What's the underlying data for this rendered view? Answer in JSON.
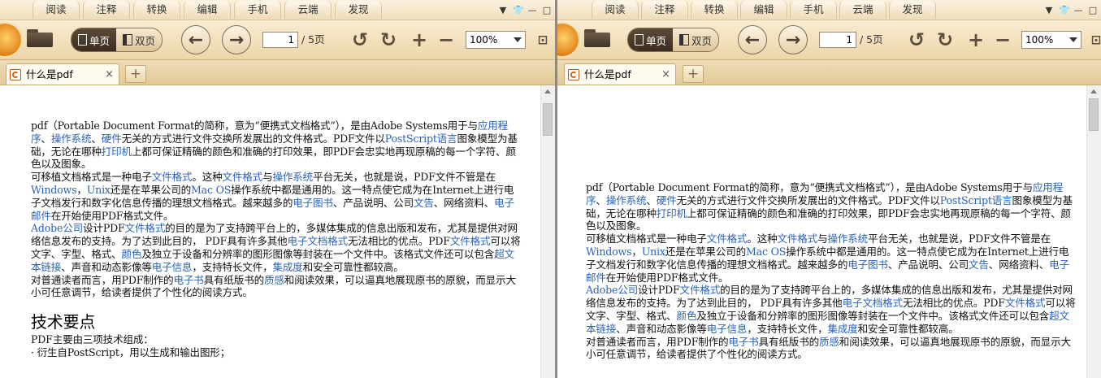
{
  "menu": [
    "阅读",
    "注释",
    "转换",
    "编辑",
    "手机",
    "云端",
    "发现"
  ],
  "toolbar": {
    "single_page_label": "单页",
    "double_page_label": "双页",
    "current_page": "1",
    "total_pages": "/ 5页",
    "zoom": "100%"
  },
  "tab": {
    "title": "什么是pdf",
    "close": "×",
    "add": "+"
  },
  "doc": {
    "p1": [
      {
        "t": "pdf（Portable Document Format的简称，意为“便携式文档格式”），是由Adobe Systems用于与"
      },
      {
        "t": "应用程序",
        "link": true
      },
      {
        "t": "、"
      },
      {
        "t": "操作系统",
        "link": true
      },
      {
        "t": "、"
      },
      {
        "t": "硬件",
        "link": true
      },
      {
        "t": "无关的方式进行文件交换所发展出的文件格式。PDF文件以"
      },
      {
        "t": "PostScript语言",
        "link": true
      },
      {
        "t": "图象模型为基础，无论在哪种"
      },
      {
        "t": "打印机",
        "link": true
      },
      {
        "t": "上都可保证精确的颜色和准确的打印效果，即PDF会忠实地再现原稿的每一个字符、颜色以及图象。"
      }
    ],
    "p2": [
      {
        "t": "可移植文档格式是一种电子"
      },
      {
        "t": "文件格式",
        "link": true
      },
      {
        "t": "。这种"
      },
      {
        "t": "文件格式",
        "link": true
      },
      {
        "t": "与"
      },
      {
        "t": "操作系统",
        "link": true
      },
      {
        "t": "平台无关，也就是说，PDF文件不管是在"
      },
      {
        "t": "Windows",
        "link": true
      },
      {
        "t": "，"
      },
      {
        "t": "Unix",
        "link": true
      },
      {
        "t": "还是在苹果公司的"
      },
      {
        "t": "Mac OS",
        "link": true
      },
      {
        "t": "操作系统中都是通用的。这一特点使它成为在Internet上进行电子文档发行和数字化信息传播的理想文档格式。越来越多的"
      },
      {
        "t": "电子图书",
        "link": true
      },
      {
        "t": "、产品说明、公司"
      },
      {
        "t": "文告",
        "link": true
      },
      {
        "t": "、网络资料、"
      },
      {
        "t": "电子邮件",
        "link": true
      },
      {
        "t": "在开始使用PDF格式文件。"
      }
    ],
    "p3": [
      {
        "t": "Adobe公司",
        "link": true
      },
      {
        "t": "设计PDF"
      },
      {
        "t": "文件格式",
        "link": true
      },
      {
        "t": "的目的是为了支持跨平台上的，多媒体集成的信息出版和发布，尤其是提供对网络信息发布的支持。为了达到此目的， PDF具有许多其他"
      },
      {
        "t": "电子文档格式",
        "link": true
      },
      {
        "t": "无法相比的优点。PDF"
      },
      {
        "t": "文件格式",
        "link": true
      },
      {
        "t": "可以将文字、字型、格式、"
      },
      {
        "t": "颜色",
        "link": true
      },
      {
        "t": "及独立于设备和分辨率的图形图像等封装在一个文件中。该格式文件还可以包含"
      },
      {
        "t": "超文本链接",
        "link": true
      },
      {
        "t": "、声音和动态影像等"
      },
      {
        "t": "电子信息",
        "link": true
      },
      {
        "t": "，支持特长文件，"
      },
      {
        "t": "集成度",
        "link": true
      },
      {
        "t": "和安全可靠性都较高。"
      }
    ],
    "p4": [
      {
        "t": "对普通读者而言，用PDF制作的"
      },
      {
        "t": "电子书",
        "link": true
      },
      {
        "t": "具有纸版书的"
      },
      {
        "t": "质感",
        "link": true
      },
      {
        "t": "和阅读效果，可以逼真地展现原书的原貌，而显示大小可任意调节，给读者提供了个性化的阅读方式。"
      }
    ],
    "heading": "技术要点",
    "p5": "PDF主要由三项技术组成：",
    "p6": "· 衍生自PostScript，用以生成和输出图形；"
  },
  "colors": {
    "link": "#2a62b8",
    "toolbar": "#ecd6a9"
  },
  "icons": [
    "app-logo-icon",
    "open-folder-icon",
    "single-page-icon",
    "double-page-icon",
    "prev-page-icon",
    "next-page-icon",
    "rotate-left-icon",
    "rotate-right-icon",
    "zoom-in-icon",
    "zoom-out-icon",
    "skin-icon",
    "pdf-file-icon",
    "dropdown-caret-icon"
  ]
}
